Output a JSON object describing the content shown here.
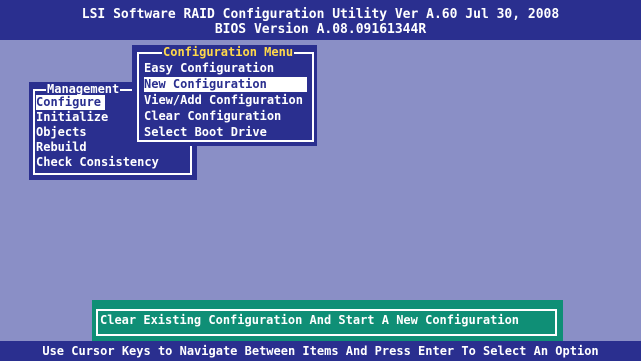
{
  "header": {
    "title": "LSI Software RAID Configuration Utility Ver A.60 Jul 30, 2008",
    "bios_version": "BIOS Version   A.08.09161344R"
  },
  "management_menu": {
    "title": "Management",
    "items": [
      {
        "label": "Configure"
      },
      {
        "label": "Initialize"
      },
      {
        "label": "Objects"
      },
      {
        "label": "Rebuild"
      },
      {
        "label": "Check Consistency"
      }
    ],
    "selected_index": 0
  },
  "configuration_menu": {
    "title": "Configuration Menu",
    "items": [
      {
        "label": "Easy Configuration"
      },
      {
        "label": "New Configuration"
      },
      {
        "label": "View/Add Configuration"
      },
      {
        "label": "Clear Configuration"
      },
      {
        "label": "Select Boot Drive"
      }
    ],
    "selected_index": 1
  },
  "help": {
    "text": "Clear Existing Configuration And Start A New Configuration"
  },
  "status_bar": {
    "text": "Use Cursor Keys to Navigate Between Items And Press Enter To Select An Option"
  },
  "colors": {
    "background": "#8a8fc6",
    "panel": "#2a2f8f",
    "menu_title_accent": "#ffd94a",
    "help_panel": "#0f8f76",
    "text": "#ffffff"
  }
}
